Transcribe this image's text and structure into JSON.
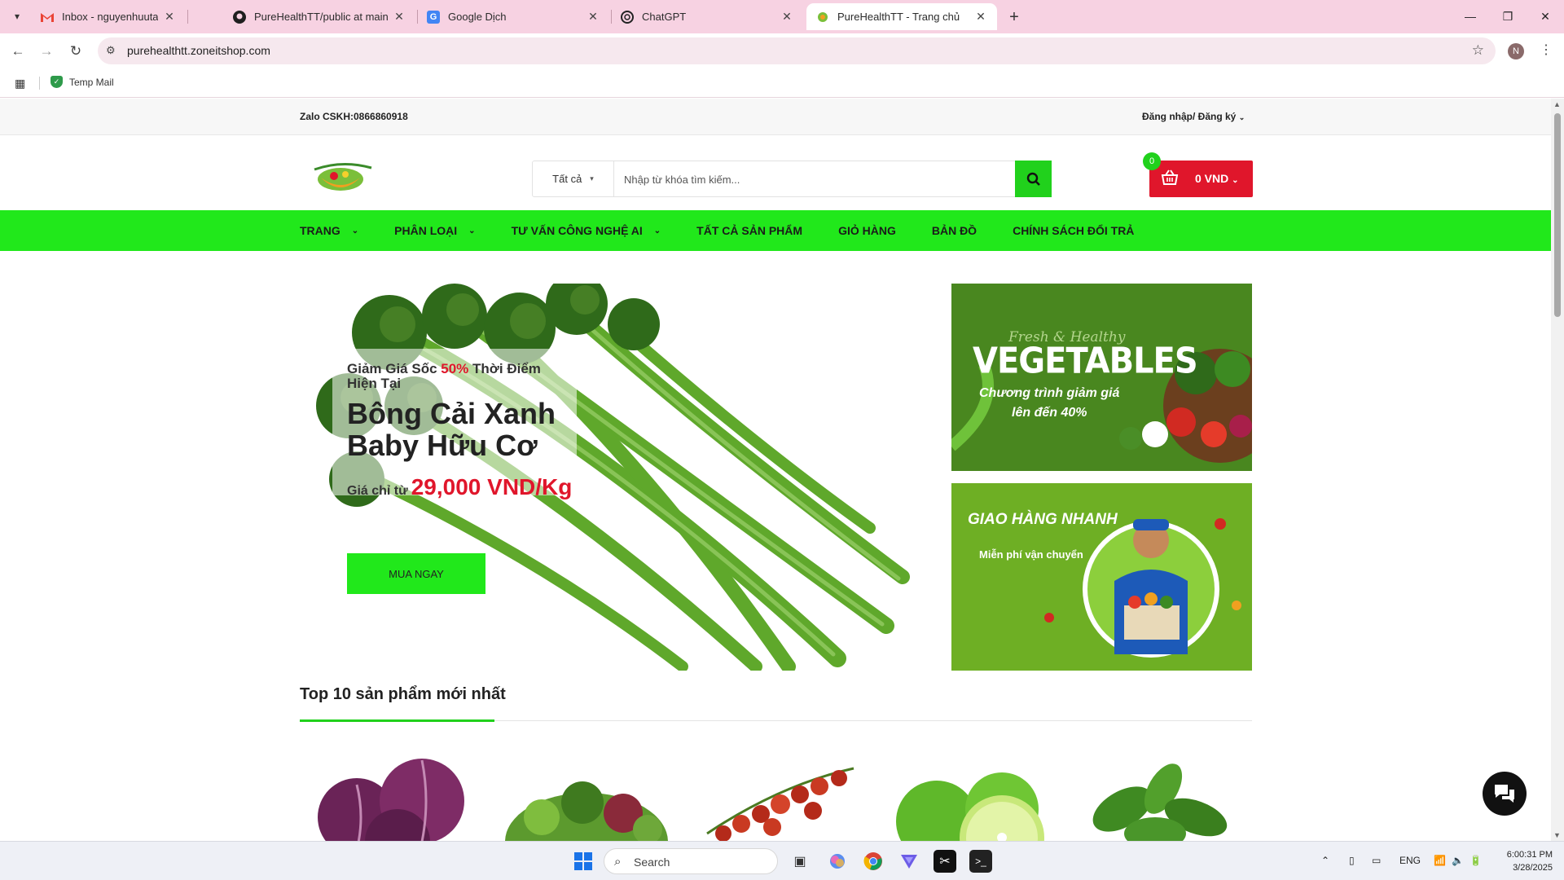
{
  "browser": {
    "tabs": [
      {
        "title": "Inbox - nguyenhuutai.reseter@",
        "icon": "gmail-icon",
        "active": false
      },
      {
        "title": "PureHealthTT/public at main · n",
        "icon": "github-icon",
        "active": false
      },
      {
        "title": "Google Dịch",
        "icon": "google-translate-icon",
        "active": false
      },
      {
        "title": "ChatGPT",
        "icon": "chatgpt-icon",
        "active": false
      },
      {
        "title": "PureHealthTT - Trang chủ",
        "icon": "site-favicon-icon",
        "active": true
      }
    ],
    "url": "purehealthtt.zoneitshop.com",
    "profile_initial": "N",
    "bookmarks": [
      {
        "label": "Temp Mail"
      }
    ]
  },
  "site": {
    "hotline": "Zalo CSKH:0866860918",
    "account": "Đăng nhập/ Đăng ký",
    "search": {
      "category": "Tất cả",
      "placeholder": "Nhập từ khóa tìm kiếm..."
    },
    "cart": {
      "count": "0",
      "total": "0 VND"
    },
    "nav": [
      {
        "label": "TRANG",
        "dropdown": true
      },
      {
        "label": "PHÂN LOẠI",
        "dropdown": true
      },
      {
        "label": "TƯ VẤN CÔNG NGHỆ AI",
        "dropdown": true
      },
      {
        "label": "TẤT CẢ SẢN PHẨM",
        "dropdown": false
      },
      {
        "label": "GIỎ HÀNG",
        "dropdown": false
      },
      {
        "label": "BẢN ĐỒ",
        "dropdown": false
      },
      {
        "label": "CHÍNH SÁCH ĐỔI TRẢ",
        "dropdown": false
      }
    ],
    "hero": {
      "tag_before": "Giảm Giá Sốc ",
      "tag_highlight": "50%",
      "tag_after": " Thời Điểm Hiện Tại",
      "name": "Bông Cải Xanh Baby Hữu Cơ",
      "price_label": "Giá chỉ từ",
      "price_value": "29,000 VND/Kg",
      "button": "MUA NGAY"
    },
    "banners": {
      "b1": {
        "script": "Fresh & Healthy",
        "title": "VEGETABLES",
        "line1": "Chương trình giảm giá",
        "line2": "lên đến 40%"
      },
      "b2": {
        "title": "GIAO HÀNG NHANH",
        "subtitle": "Miễn phí vận chuyển"
      }
    },
    "section_title": "Top 10 sản phẩm mới nhất",
    "products": [
      {
        "image": "red-cabbage"
      },
      {
        "image": "mixed-salad-greens"
      },
      {
        "image": "cherry-tomatoes"
      },
      {
        "image": "limes"
      },
      {
        "image": "basil"
      }
    ]
  },
  "colors": {
    "brand_green": "#21e81b",
    "button_green": "#21d11c",
    "cart_red": "#e0162b",
    "tab_bar": "#f7d2e2"
  },
  "taskbar": {
    "search_label": "Search",
    "language": "ENG",
    "time": "6:00:31 PM",
    "date": "3/28/2025"
  }
}
